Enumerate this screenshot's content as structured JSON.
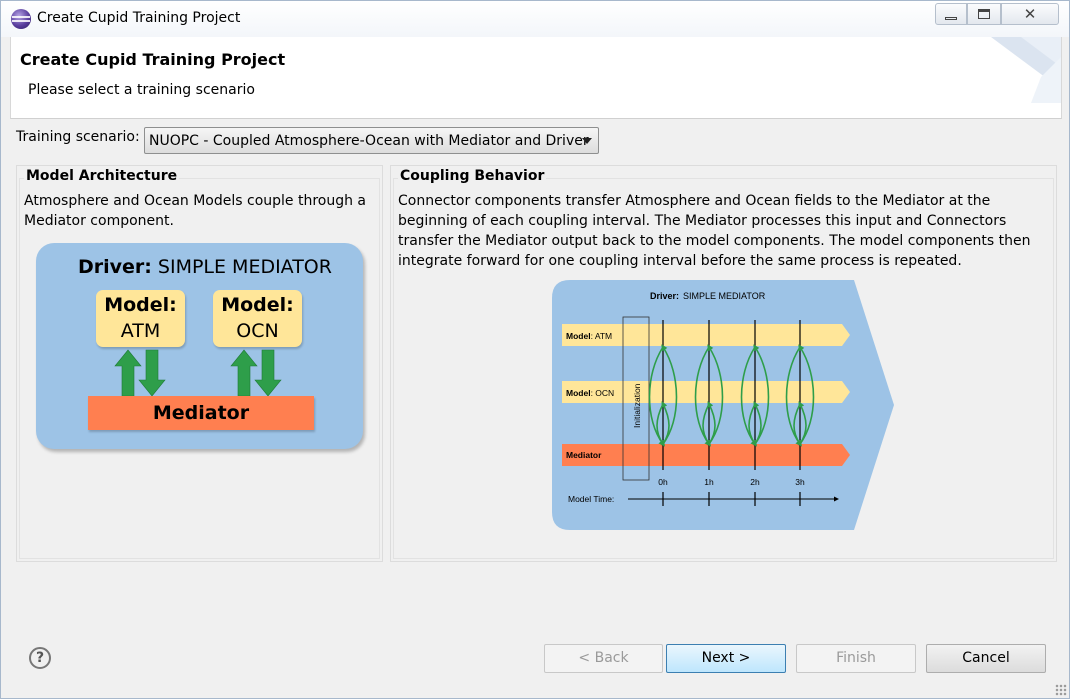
{
  "window": {
    "title": "Create Cupid Training Project",
    "minimize_glyph": "",
    "maximize_glyph": "",
    "close_glyph": "✕"
  },
  "banner": {
    "title": "Create Cupid Training Project",
    "subtitle": "Please select a training scenario"
  },
  "scenario": {
    "label": "Training scenario:",
    "selected": "NUOPC - Coupled Atmosphere-Ocean with Mediator and Driver"
  },
  "model_architecture": {
    "heading": "Model Architecture",
    "description": "Atmosphere and Ocean Models couple through a Mediator component.",
    "diagram": {
      "driver_keyword": "Driver:",
      "driver_name": "SIMPLE MEDIATOR",
      "model_keyword": "Model:",
      "models": [
        "ATM",
        "OCN"
      ],
      "mediator": "Mediator",
      "colors": {
        "background": "#9dc3e6",
        "model": "#ffe699",
        "mediator": "#ff7f50",
        "arrow": "#2e9e4a"
      }
    }
  },
  "coupling_behavior": {
    "heading": "Coupling Behavior",
    "description": "Connector components transfer Atmosphere and Ocean fields to the Mediator at the beginning of each coupling interval. The Mediator processes this input and Connectors transfer the Mediator output back to the model components. The model components then integrate forward for one coupling interval before the same process is repeated.",
    "diagram": {
      "driver_keyword": "Driver:",
      "driver_name": "SIMPLE MEDIATOR",
      "model_atm_keyword": "Model",
      "model_atm_name": ": ATM",
      "model_ocn_keyword": "Model",
      "model_ocn_name": ": OCN",
      "mediator": "Mediator",
      "initialization": "Initialization",
      "time_label": "Model Time:",
      "time_ticks": [
        "0h",
        "1h",
        "2h",
        "3h"
      ]
    }
  },
  "buttons": {
    "help": "?",
    "back": "< Back",
    "next": "Next >",
    "finish": "Finish",
    "cancel": "Cancel"
  }
}
